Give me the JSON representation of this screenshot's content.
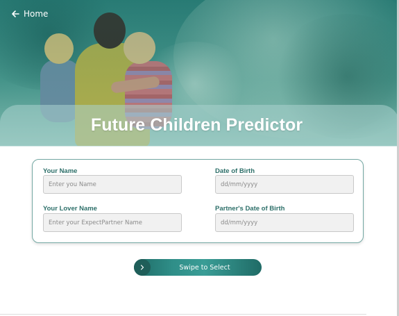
{
  "nav": {
    "home_label": "Home"
  },
  "hero": {
    "title": "Future Children Predictor"
  },
  "form": {
    "your_name": {
      "label": "Your Name",
      "placeholder": "Enter you Name"
    },
    "date_of_birth": {
      "label": "Date of Birth",
      "placeholder": "dd/mm/yyyy"
    },
    "lover_name": {
      "label": "Your Lover Name",
      "placeholder": "Enter your ExpectPartner Name"
    },
    "partner_dob": {
      "label": "Partner's Date of Birth",
      "placeholder": "dd/mm/yyyy"
    }
  },
  "swipe": {
    "label": "Swipe to Select"
  },
  "icons": {
    "back": "arrow-left-icon",
    "swipe_handle": "chevron-right-icon"
  },
  "colors": {
    "accent": "#2d6f69",
    "button": "#1f6b66",
    "hero_tint": "#4d9a8f"
  }
}
